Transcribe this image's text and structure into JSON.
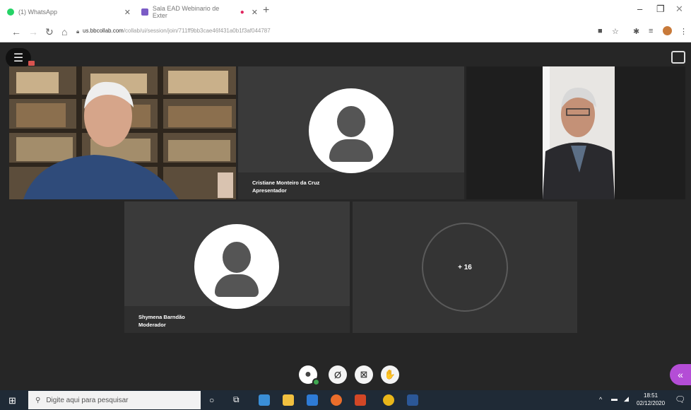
{
  "browser": {
    "tabs": [
      {
        "title": "(1) WhatsApp",
        "favicon_color": "#25d366"
      },
      {
        "title": "Sala EAD Webinario de Exter",
        "favicon_color": "#7b5cc6"
      }
    ],
    "url_domain": "us.bbcollab.com",
    "url_path": "/collab/ui/session/join/711ff9bb3cae46f431a0b1f3af044787",
    "new_tab": "+",
    "win_minimize": "–",
    "win_restore": "❐",
    "win_close": "✕"
  },
  "meeting": {
    "participants": [
      {
        "name": "Cristiane Monteiro da Cruz",
        "role": "Apresentador"
      },
      {
        "name": "Shymena Barndão",
        "role": "Moderador"
      }
    ],
    "overflow_count": "+ 16",
    "accent_color": "#b44dd6"
  },
  "taskbar": {
    "search_placeholder": "Digite aqui para pesquisar",
    "time": "18:51",
    "date": "02/12/2020"
  }
}
